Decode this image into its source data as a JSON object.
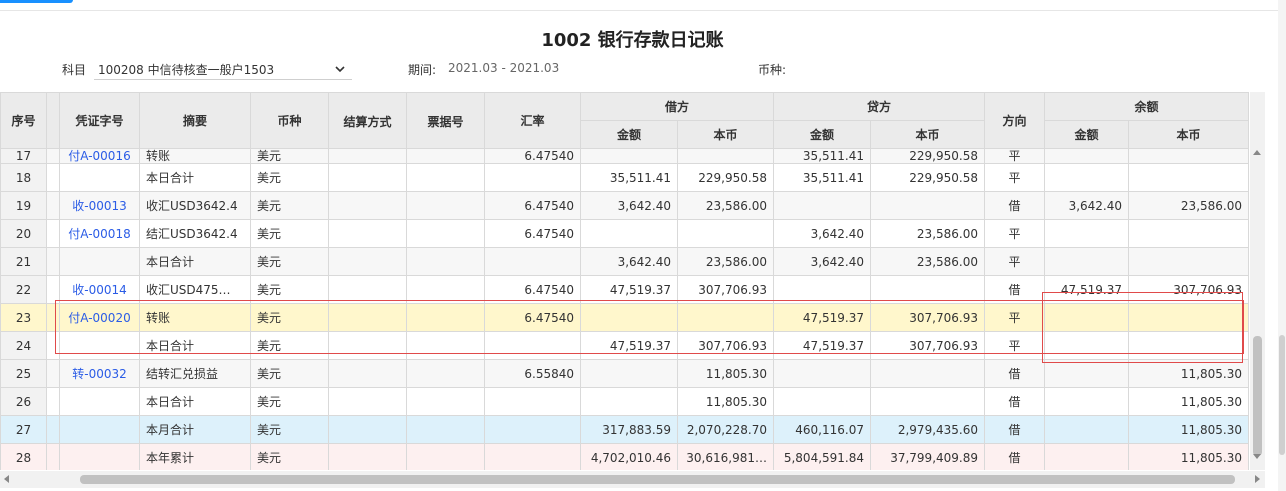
{
  "title": "1002 银行存款日记账",
  "filters": {
    "subject_label": "科目",
    "subject_value": "100208 中信待核查一般户1503",
    "period_label": "期间:",
    "period_value": "2021.03 - 2021.03",
    "currency_label": "币种:",
    "currency_value": ""
  },
  "columns": {
    "seq": "序号",
    "voucher": "凭证字号",
    "summary": "摘要",
    "currency": "币种",
    "settle": "结算方式",
    "bill": "票据号",
    "rate": "汇率",
    "debit": "借方",
    "credit": "贷方",
    "direction": "方向",
    "balance": "余额",
    "amount": "金额",
    "local": "本币"
  },
  "rows": [
    {
      "seq": "17",
      "voucher": "付A-00016",
      "summary": "转账",
      "currency": "美元",
      "settle": "",
      "bill": "",
      "rate": "6.47540",
      "debit_amt": "",
      "debit_local": "",
      "credit_amt": "35,511.41",
      "credit_local": "229,950.58",
      "dir": "平",
      "bal_amt": "",
      "bal_local": ""
    },
    {
      "seq": "18",
      "voucher": "",
      "summary": "本日合计",
      "currency": "美元",
      "settle": "",
      "bill": "",
      "rate": "",
      "debit_amt": "35,511.41",
      "debit_local": "229,950.58",
      "credit_amt": "35,511.41",
      "credit_local": "229,950.58",
      "dir": "平",
      "bal_amt": "",
      "bal_local": ""
    },
    {
      "seq": "19",
      "voucher": "收-00013",
      "summary": "收汇USD3642.4",
      "currency": "美元",
      "settle": "",
      "bill": "",
      "rate": "6.47540",
      "debit_amt": "3,642.40",
      "debit_local": "23,586.00",
      "credit_amt": "",
      "credit_local": "",
      "dir": "借",
      "bal_amt": "3,642.40",
      "bal_local": "23,586.00"
    },
    {
      "seq": "20",
      "voucher": "付A-00018",
      "summary": "结汇USD3642.4",
      "currency": "美元",
      "settle": "",
      "bill": "",
      "rate": "6.47540",
      "debit_amt": "",
      "debit_local": "",
      "credit_amt": "3,642.40",
      "credit_local": "23,586.00",
      "dir": "平",
      "bal_amt": "",
      "bal_local": ""
    },
    {
      "seq": "21",
      "voucher": "",
      "summary": "本日合计",
      "currency": "美元",
      "settle": "",
      "bill": "",
      "rate": "",
      "debit_amt": "3,642.40",
      "debit_local": "23,586.00",
      "credit_amt": "3,642.40",
      "credit_local": "23,586.00",
      "dir": "平",
      "bal_amt": "",
      "bal_local": ""
    },
    {
      "seq": "22",
      "voucher": "收-00014",
      "summary": "收汇USD475…",
      "currency": "美元",
      "settle": "",
      "bill": "",
      "rate": "6.47540",
      "debit_amt": "47,519.37",
      "debit_local": "307,706.93",
      "credit_amt": "",
      "credit_local": "",
      "dir": "借",
      "bal_amt": "47,519.37",
      "bal_local": "307,706.93"
    },
    {
      "seq": "23",
      "voucher": "付A-00020",
      "summary": "转账",
      "currency": "美元",
      "settle": "",
      "bill": "",
      "rate": "6.47540",
      "debit_amt": "",
      "debit_local": "",
      "credit_amt": "47,519.37",
      "credit_local": "307,706.93",
      "dir": "平",
      "bal_amt": "",
      "bal_local": ""
    },
    {
      "seq": "24",
      "voucher": "",
      "summary": "本日合计",
      "currency": "美元",
      "settle": "",
      "bill": "",
      "rate": "",
      "debit_amt": "47,519.37",
      "debit_local": "307,706.93",
      "credit_amt": "47,519.37",
      "credit_local": "307,706.93",
      "dir": "平",
      "bal_amt": "",
      "bal_local": ""
    },
    {
      "seq": "25",
      "voucher": "转-00032",
      "summary": "结转汇兑损益",
      "currency": "美元",
      "settle": "",
      "bill": "",
      "rate": "6.55840",
      "debit_amt": "",
      "debit_local": "11,805.30",
      "credit_amt": "",
      "credit_local": "",
      "dir": "借",
      "bal_amt": "",
      "bal_local": "11,805.30"
    },
    {
      "seq": "26",
      "voucher": "",
      "summary": "本日合计",
      "currency": "美元",
      "settle": "",
      "bill": "",
      "rate": "",
      "debit_amt": "",
      "debit_local": "11,805.30",
      "credit_amt": "",
      "credit_local": "",
      "dir": "借",
      "bal_amt": "",
      "bal_local": "11,805.30"
    },
    {
      "seq": "27",
      "voucher": "",
      "summary": "本月合计",
      "currency": "美元",
      "settle": "",
      "bill": "",
      "rate": "",
      "debit_amt": "317,883.59",
      "debit_local": "2,070,228.70",
      "credit_amt": "460,116.07",
      "credit_local": "2,979,435.60",
      "dir": "借",
      "bal_amt": "",
      "bal_local": "11,805.30"
    },
    {
      "seq": "28",
      "voucher": "",
      "summary": "本年累计",
      "currency": "美元",
      "settle": "",
      "bill": "",
      "rate": "",
      "debit_amt": "4,702,010.46",
      "debit_local": "30,616,981…",
      "credit_amt": "5,804,591.84",
      "credit_local": "37,799,409.89",
      "dir": "借",
      "bal_amt": "",
      "bal_local": "11,805.30"
    }
  ],
  "colors": {
    "accent": "#1890ff",
    "link": "#2b5ce6",
    "selected_row": "#fff7cc",
    "month_row": "#ddf1fb",
    "year_row": "#fdf0f0",
    "annotation": "#e04a4a"
  },
  "icons": {
    "subject_dropdown": "chevron-down-icon"
  }
}
